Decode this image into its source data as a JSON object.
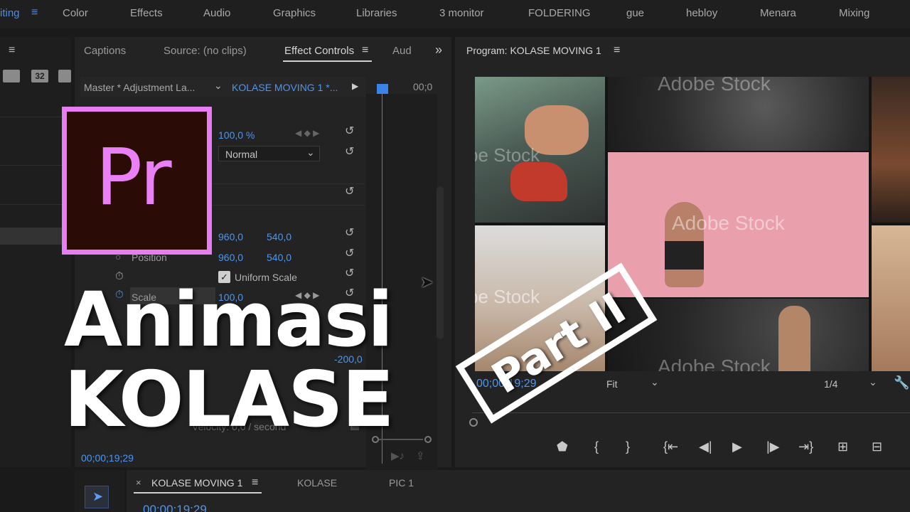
{
  "workspace_tabs": {
    "items": [
      "iting",
      "Color",
      "Effects",
      "Audio",
      "Graphics",
      "Libraries",
      "3 monitor",
      "FOLDERING",
      "gue",
      "hebloy",
      "Menara",
      "Mixing"
    ],
    "active_index": 0
  },
  "left_panel": {
    "icon_label": "32"
  },
  "effect_panel": {
    "tabs": [
      "Captions",
      "Source: (no clips)",
      "Effect Controls",
      "Aud"
    ],
    "active_tab": "Effect Controls",
    "master_label": "Master * Adjustment La...",
    "sequence_label": "KOLASE MOVING 1 *...",
    "timecode_head": "00;0",
    "opacity_value": "100,0 %",
    "blend_mode": "Normal",
    "anchor_x": "960,0",
    "anchor_y": "540,0",
    "position_label": "Position",
    "position_x": "960,0",
    "position_y": "540,0",
    "uniform_scale_label": "Uniform Scale",
    "scale_label": "Scale",
    "scale_value": "100,0",
    "velocity_value": "-200,0",
    "velocity_label": "Velocity: 0,0 / second",
    "timecode": "00;00;19;29"
  },
  "program_monitor": {
    "title": "Program: KOLASE MOVING 1",
    "timecode": "00;00;19;29",
    "fit_label": "Fit",
    "resolution_label": "1/4",
    "watermark": "Adobe Stock",
    "watermark_partial": "be Stock"
  },
  "timeline": {
    "tabs": [
      "KOLASE MOVING 1",
      "KOLASE",
      "PIC 1"
    ],
    "active_tab": "KOLASE MOVING 1",
    "timecode": "00;00;19;29"
  },
  "overlay": {
    "logo_text": "Pr",
    "title_line1": "Animasi",
    "title_line2": "KOLASE",
    "part_label": "Part II"
  },
  "colors": {
    "accent_blue": "#4a8df0",
    "logo_border": "#e77cf3",
    "logo_bg": "#2b0b05",
    "panel_bg": "#232323"
  }
}
